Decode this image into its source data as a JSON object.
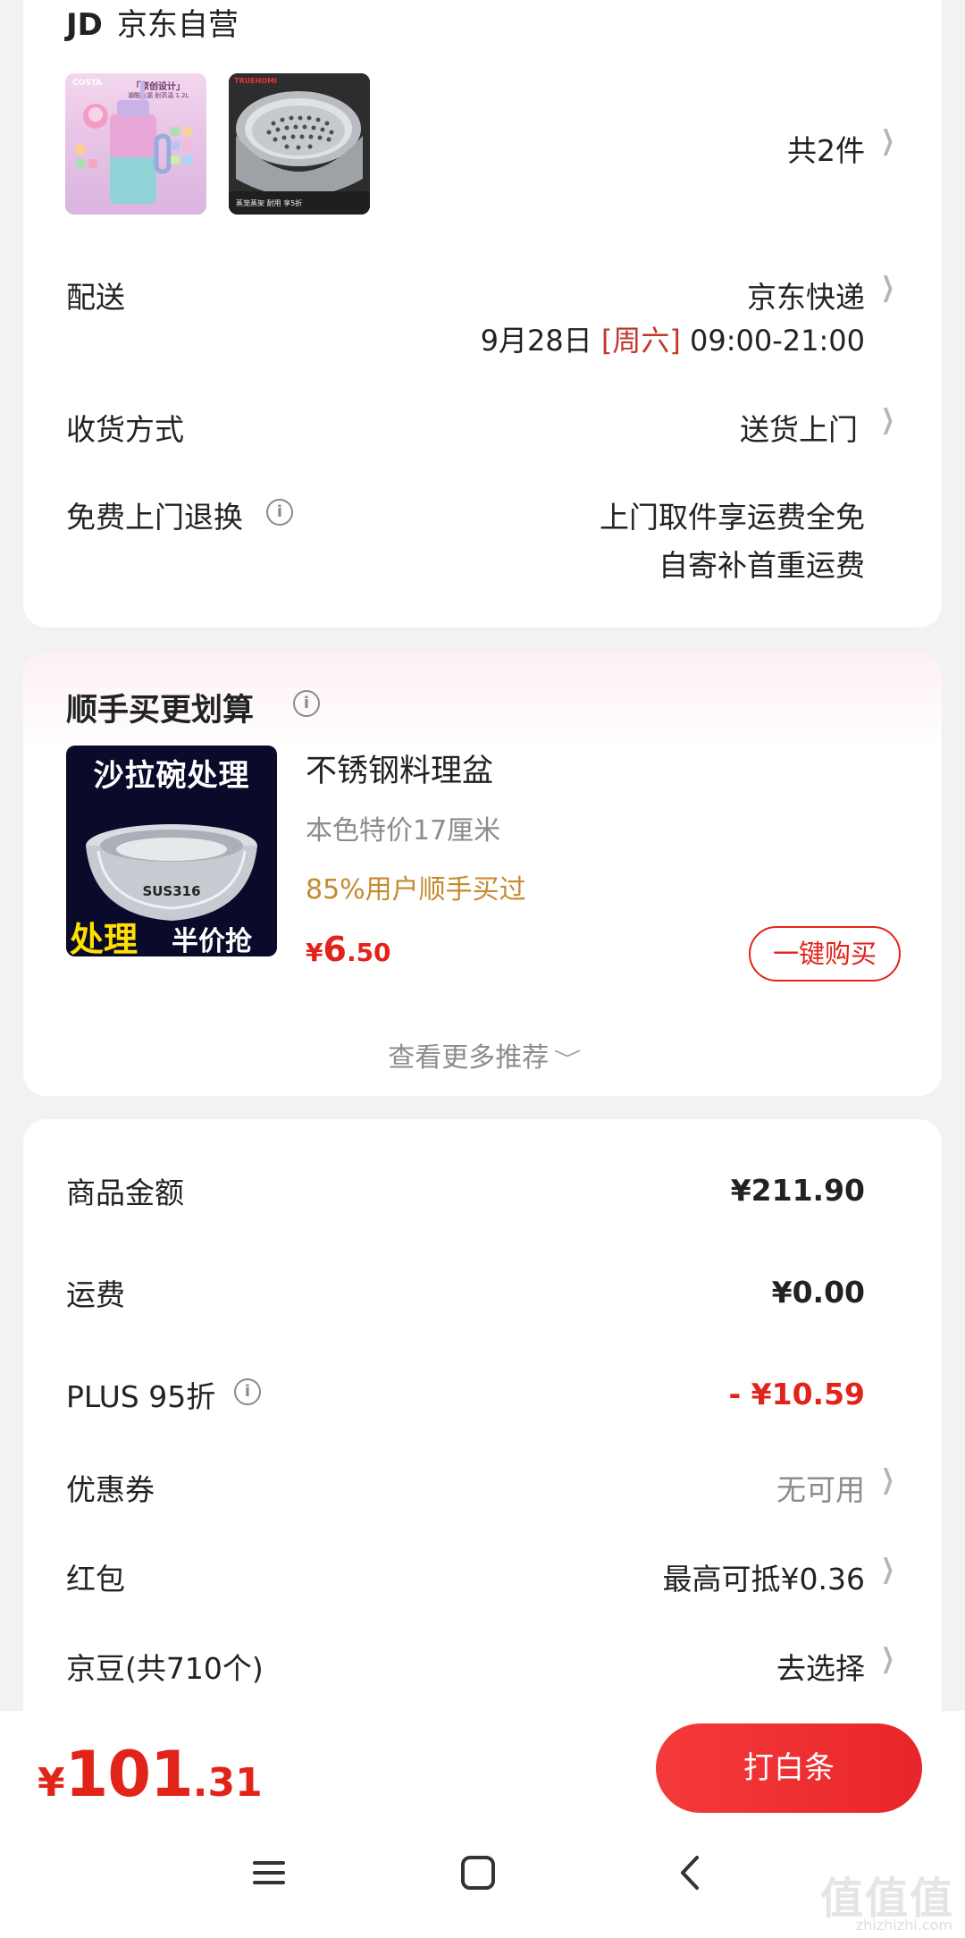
{
  "shop": {
    "logo": "JD",
    "name": "京东自营",
    "items_count": "共2件",
    "product1": {
      "brand": "COSTA",
      "badge": "「原创设计」",
      "note": "潮酷防漏 耐高温 1.2L"
    },
    "product2": {
      "brand": "TRUEHOMI",
      "note": "蒸笼蒸架 耐用 享5折"
    }
  },
  "delivery": {
    "label": "配送",
    "carrier": "京东快递",
    "date": "9月28日",
    "weekday": "[周六]",
    "time": "09:00-21:00"
  },
  "receive": {
    "label": "收货方式",
    "value": "送货上门"
  },
  "returns": {
    "label": "免费上门退换",
    "line1": "上门取件享运费全免",
    "line2": "自寄补首重运费"
  },
  "bundle": {
    "title": "顺手买更划算",
    "image_text_top": "沙拉碗处理",
    "image_text_model": "SUS316",
    "image_text_bottom_left": "处理",
    "image_text_bottom_right": "半价抢",
    "product_name": "不锈钢料理盆",
    "spec": "本色特价17厘米",
    "stat": "85%用户顺手买过",
    "price_currency": "¥",
    "price_int": "6",
    "price_dec": ".50",
    "buy_button": "一键购买",
    "more": "查看更多推荐"
  },
  "summary": {
    "goods_label": "商品金额",
    "goods_value": "¥211.90",
    "shipping_label": "运费",
    "shipping_value": "¥0.00",
    "plus_label": "PLUS 95折",
    "plus_value": "- ¥10.59",
    "coupon_label": "优惠券",
    "coupon_value": "无可用",
    "redpacket_label": "红包",
    "redpacket_value": "最高可抵¥0.36",
    "beans_label": "京豆(共710个)",
    "beans_value": "去选择"
  },
  "footer": {
    "currency": "¥",
    "total_int": "101",
    "total_dec": ".31",
    "pay_button": "打白条",
    "watermark": "值值值",
    "watermark_url": "zhizhizhi.com"
  },
  "colors": {
    "accent_red": "#e2231a",
    "gold": "#c68a2e",
    "grey_text": "#8c8c8c"
  }
}
